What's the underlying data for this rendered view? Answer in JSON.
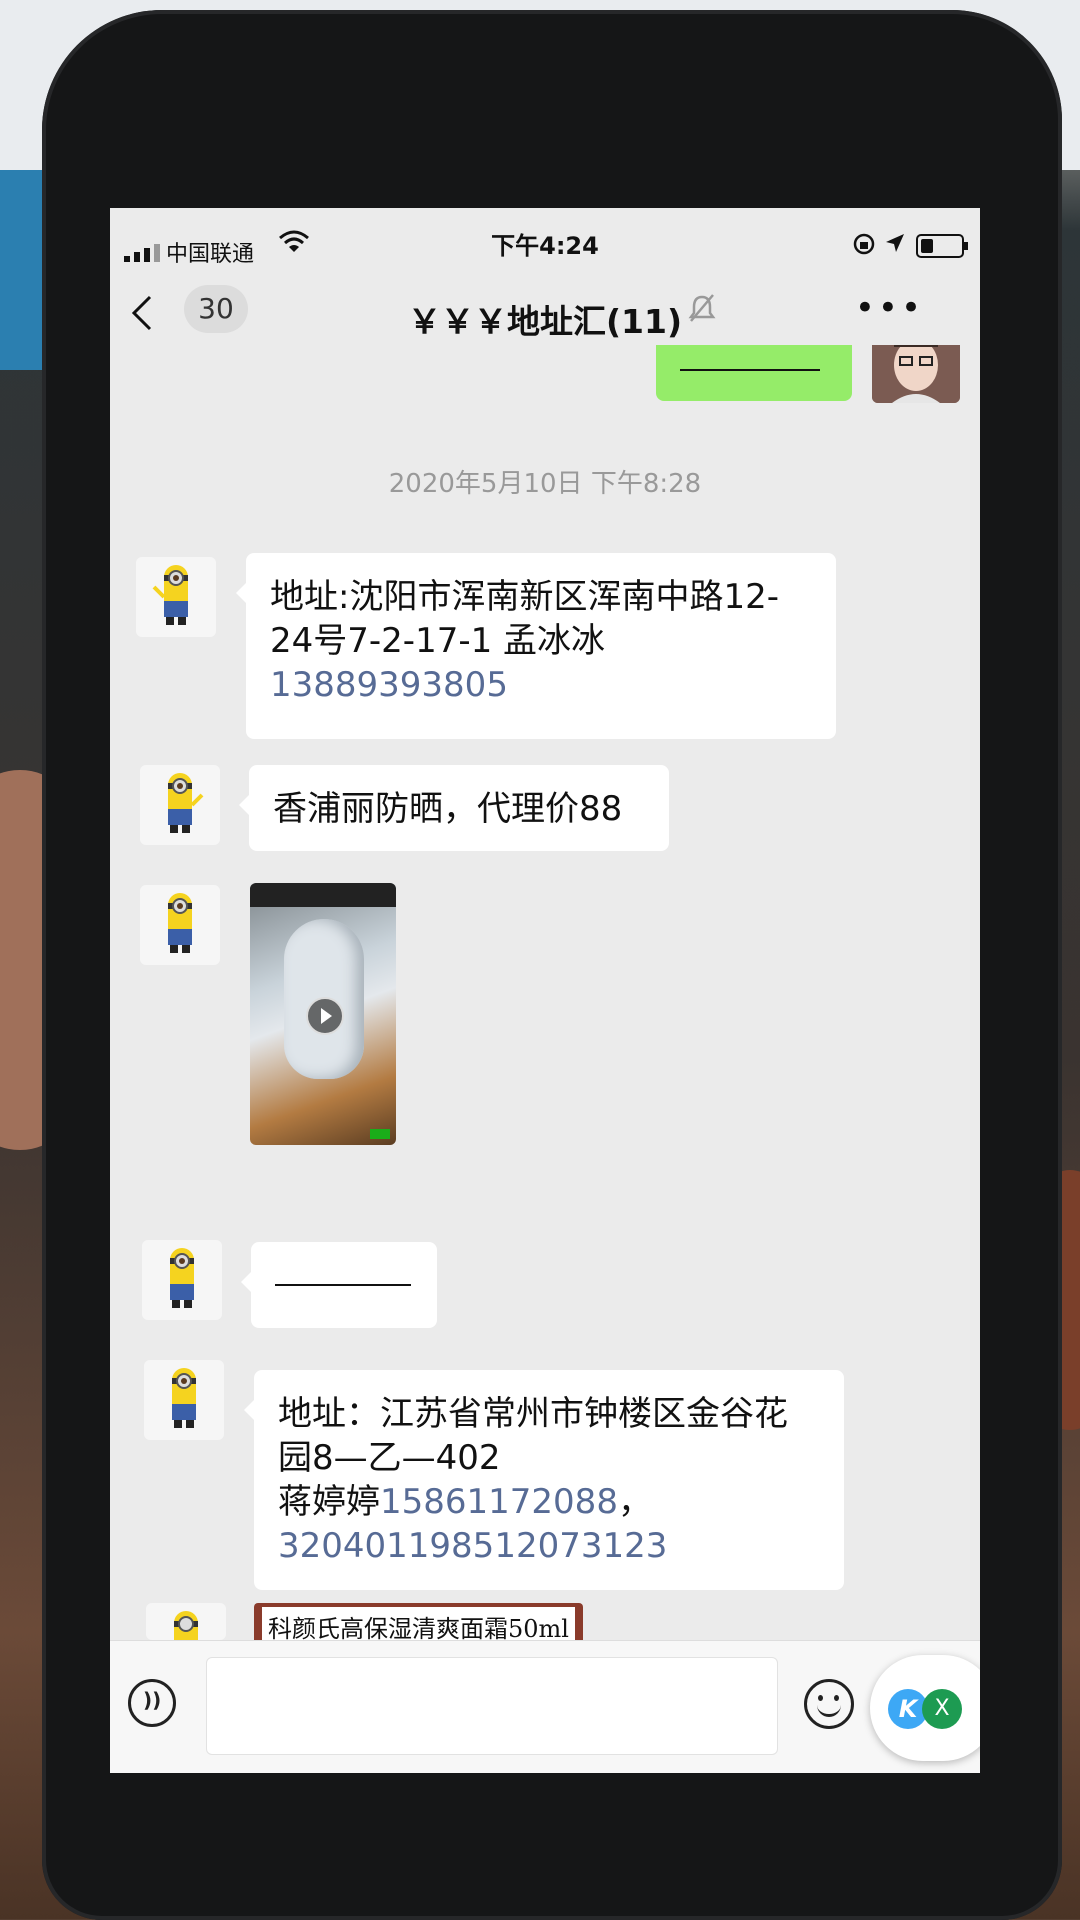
{
  "status_bar": {
    "carrier": "中国联通",
    "time": "下午4:24"
  },
  "nav": {
    "unread_count": "30",
    "title": "￥￥￥地址汇(11)"
  },
  "messages": {
    "timestamp": "2020年5月10日 下午8:28",
    "msg1": {
      "line1": "地址:沈阳市浑南新区浑南中路12-",
      "line2": "24号7-2-17-1 孟冰冰",
      "phone": "13889393805"
    },
    "msg2": "香浦丽防晒，代理价88",
    "msg5": {
      "line1": "地址：江苏省常州市钟楼区金谷花",
      "line2": "园8—乙—402",
      "name": "蒋婷婷",
      "phone": "15861172088",
      "sep": "，",
      "id_number": "320401198512073123"
    },
    "image_caption": "科颜氏高保湿清爽面霜50ml"
  },
  "icons": {
    "back": "chevron-left",
    "mute": "bell-slash",
    "more": "ellipsis",
    "voice": "voice",
    "emoji": "smiley"
  },
  "floating_widget": {
    "k_label": "K",
    "x_label": "X"
  },
  "colors": {
    "self_bubble": "#95ec69",
    "link": "#576b95",
    "chat_bg": "#ebebeb"
  }
}
